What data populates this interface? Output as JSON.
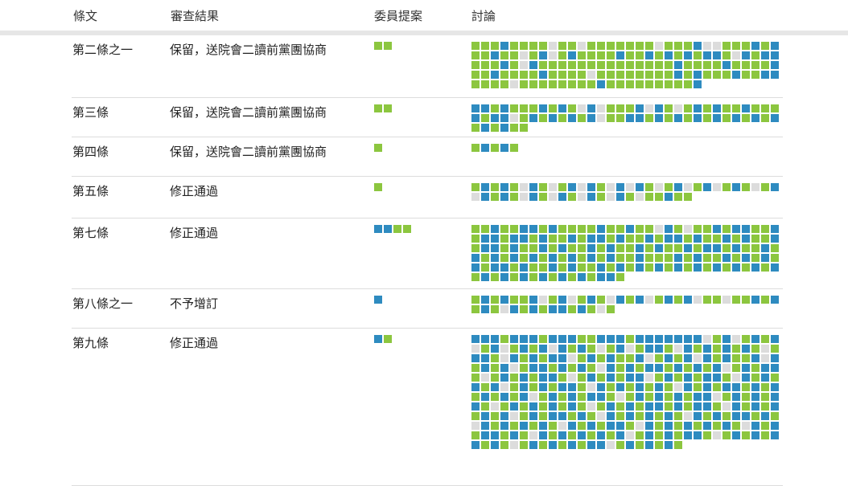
{
  "colors": {
    "green": "#8cc63f",
    "blue": "#2e8bc0",
    "gray": "#dcdcdc"
  },
  "header": {
    "col_article": "條文",
    "col_result": "審查結果",
    "col_proposals": "委員提案",
    "col_discussion": "討論"
  },
  "rows": [
    {
      "article": "第二條之一",
      "result": "保留，送院會二讀前黨團協商",
      "proposals": "gg",
      "discussion": "gggbggggxggxgggggggxgggbxxgggbgbggbggxgbxgbggggbggbgbgbgbbgxbgbbgggbgxbggggggggggggggbggggbggggbggbggggbggggxggggggggbgbgggbggbbggggxggggggggbgggggggggb"
    },
    {
      "article": "第三條",
      "result": "保留，送院會二讀前黨團協商",
      "proposals": "gg",
      "discussion": "bbgbgggbgbgxbxgggbxbgxgbgbggbgggbgbbxgbgbgbgbxggbbgbgbgbgbgbgbgbgbgbgg"
    },
    {
      "article": "第四條",
      "result": "保留，送院會二讀前黨團協商",
      "proposals": "g",
      "discussion": "gbgbg"
    },
    {
      "article": "第五條",
      "result": "修正通過",
      "proposals": "g",
      "discussion": "gbgbgxbgxgbxbgxbxbgxgbxgbxgbgxgbxbgbgxbgxbgxbgxbgxggbgg"
    },
    {
      "article": "第七條",
      "result": "修正通過",
      "proposals": "bbgg",
      "discussion": "ggbggbbgbggggbggbggxbgxggbgbbggbgbbgbbgbggbgbbgbggbgbbgbggbgbggbgbbgbggbgbggbgbggbgbggbgbbgbggbgbgbgbgbgbgbgbgbggbgggbgbggbgbgbgbgbbgbggbgbggbgbgbgbgbgbgbgbgbgbgbgbgbgbgbgbgbbg"
    },
    {
      "article": "第八條之一",
      "result": "不予增訂",
      "proposals": "b",
      "discussion": "gbgbggbxgbxgbgxbgbxgbgbxggxggbgbgbgxbgbgbbgbgxg"
    },
    {
      "article": "第九條",
      "result": "修正通過",
      "proposals": "bg",
      "discussion": "bbbgbbbgbbbggbbbgbbbbbbbxgbxgbgbxgbxgbgbxbgbgxgbxgbbgxbgbgbgbgxgbbgxbgbgbbxgbgbggbxgbgbxbgbggbxbgbgbxgbbgbgbgxbgbgbbgbgbgbxgbgbbgxgbgbgbbgxgbgbgbbxgbgbgbbgxbgbgbgbxgbgbgbbgxbgbgbgbgxbgbgbbgbgbgbgbgbxgbgbgbbgxgbgbgbgbbxgbgbgbbgxgbgbgbgbgxgbgbgbbgbgbbgxbgbgbgbgbxgbgbbgbgxbgbgbgbgxbgbgbbgbgxbgbgbgbgxbgbgbbgxbgbgbgbgbgxbgbgbbgbgxbgbgbgbgbxgbgbgbbgxgbgbgbbgbgxgbgbgbgbbxgbgbgbg"
    }
  ]
}
